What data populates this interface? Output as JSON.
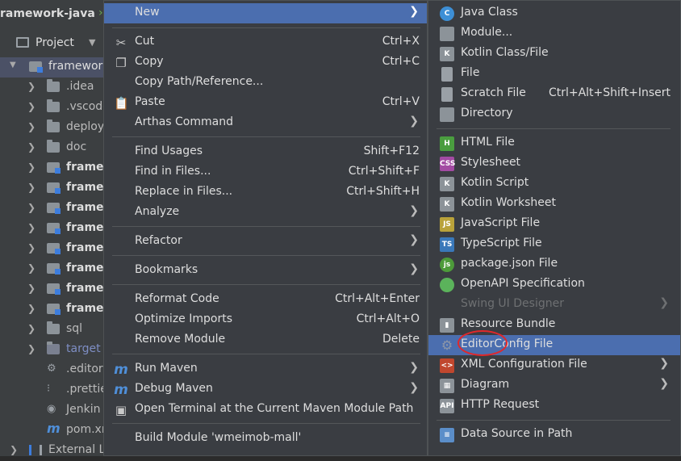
{
  "window": {
    "breadcrumb": "ramework-java"
  },
  "project_panel": {
    "header": "Project",
    "tree": [
      {
        "label": "framework",
        "type": "module",
        "expanded": true,
        "selected": true
      },
      {
        "label": ".idea",
        "type": "folder"
      },
      {
        "label": ".vscode",
        "type": "folder"
      },
      {
        "label": "deploy",
        "type": "folder"
      },
      {
        "label": "doc",
        "type": "folder"
      },
      {
        "label": "framew",
        "type": "module",
        "bold": true
      },
      {
        "label": "framew",
        "type": "module",
        "bold": true
      },
      {
        "label": "framew",
        "type": "module",
        "bold": true
      },
      {
        "label": "framew",
        "type": "module",
        "bold": true
      },
      {
        "label": "framew",
        "type": "module",
        "bold": true
      },
      {
        "label": "framew",
        "type": "module",
        "bold": true
      },
      {
        "label": "framew",
        "type": "module",
        "bold": true
      },
      {
        "label": "framew",
        "type": "module",
        "bold": true
      },
      {
        "label": "sql",
        "type": "folder"
      },
      {
        "label": "target",
        "type": "folder",
        "excluded": true
      },
      {
        "label": ".editor",
        "type": "file"
      },
      {
        "label": ".prettie",
        "type": "file"
      },
      {
        "label": "Jenkin",
        "type": "file"
      },
      {
        "label": "pom.xr",
        "type": "file"
      },
      {
        "label": "External Li",
        "type": "lib"
      }
    ]
  },
  "context_menu": {
    "items": [
      {
        "label": "New",
        "submenu": true,
        "highlighted": true
      },
      {
        "sep": true
      },
      {
        "label": "Cut",
        "shortcut": "Ctrl+X",
        "icon": "scissors-icon"
      },
      {
        "label": "Copy",
        "shortcut": "Ctrl+C",
        "icon": "copy-icon"
      },
      {
        "label": "Copy Path/Reference..."
      },
      {
        "label": "Paste",
        "shortcut": "Ctrl+V",
        "icon": "paste-icon"
      },
      {
        "label": "Arthas Command",
        "submenu": true
      },
      {
        "sep": true
      },
      {
        "label": "Find Usages",
        "shortcut": "Shift+F12"
      },
      {
        "label": "Find in Files...",
        "shortcut": "Ctrl+Shift+F"
      },
      {
        "label": "Replace in Files...",
        "shortcut": "Ctrl+Shift+H"
      },
      {
        "label": "Analyze",
        "submenu": true
      },
      {
        "sep": true
      },
      {
        "label": "Refactor",
        "submenu": true
      },
      {
        "sep": true
      },
      {
        "label": "Bookmarks",
        "submenu": true
      },
      {
        "sep": true
      },
      {
        "label": "Reformat Code",
        "shortcut": "Ctrl+Alt+Enter"
      },
      {
        "label": "Optimize Imports",
        "shortcut": "Ctrl+Alt+O"
      },
      {
        "label": "Remove Module",
        "shortcut": "Delete"
      },
      {
        "sep": true
      },
      {
        "label": "Run Maven",
        "submenu": true,
        "icon": "maven-icon"
      },
      {
        "label": "Debug Maven",
        "submenu": true,
        "icon": "maven-debug-icon"
      },
      {
        "label": "Open Terminal at the Current Maven Module Path",
        "icon": "terminal-icon"
      },
      {
        "sep": true
      },
      {
        "label": "Build Module 'wmeimob-mall'"
      }
    ]
  },
  "new_submenu": {
    "items": [
      {
        "label": "Java Class",
        "icon": "java-class-icon",
        "badge": "C",
        "color": "#3d8fd6",
        "round": true
      },
      {
        "label": "Module...",
        "icon": "module-icon",
        "color": "#8c9399"
      },
      {
        "label": "Kotlin Class/File",
        "icon": "kotlin-icon",
        "badge": "K",
        "color": "#8c9399"
      },
      {
        "label": "File",
        "icon": "file-icon",
        "color": "#9aa0a6"
      },
      {
        "label": "Scratch File",
        "shortcut": "Ctrl+Alt+Shift+Insert",
        "icon": "scratch-file-icon",
        "color": "#9aa0a6"
      },
      {
        "label": "Directory",
        "icon": "directory-icon",
        "color": "#8c9399"
      },
      {
        "sep": true
      },
      {
        "label": "HTML File",
        "icon": "html-icon",
        "badge": "H",
        "color": "#4a9d3f"
      },
      {
        "label": "Stylesheet",
        "icon": "css-icon",
        "badge": "CSS",
        "color": "#a34ba3"
      },
      {
        "label": "Kotlin Script",
        "icon": "kotlin-script-icon",
        "badge": "K",
        "color": "#8c9399"
      },
      {
        "label": "Kotlin Worksheet",
        "icon": "kotlin-worksheet-icon",
        "badge": "K",
        "color": "#8c9399"
      },
      {
        "label": "JavaScript File",
        "icon": "javascript-icon",
        "badge": "JS",
        "color": "#b9a23a"
      },
      {
        "label": "TypeScript File",
        "icon": "typescript-icon",
        "badge": "TS",
        "color": "#3a78b9"
      },
      {
        "label": "package.json File",
        "icon": "nodejs-icon",
        "badge": "js",
        "color": "#4d9b3a",
        "round": true
      },
      {
        "label": "OpenAPI Specification",
        "icon": "openapi-icon",
        "badge": "",
        "color": "#5bb35b",
        "round": true
      },
      {
        "label": "Swing UI Designer",
        "submenu": true,
        "disabled": true
      },
      {
        "label": "Resource Bundle",
        "icon": "resource-bundle-icon",
        "badge": "▮",
        "color": "#8c9399"
      },
      {
        "label": "EditorConfig File",
        "icon": "gear-icon",
        "badge": "⚙",
        "color": "#6b7a99",
        "highlighted": true
      },
      {
        "label": "XML Configuration File",
        "submenu": true,
        "icon": "xml-icon",
        "badge": "<>",
        "color": "#c0472e"
      },
      {
        "label": "Diagram",
        "submenu": true,
        "icon": "diagram-icon",
        "badge": "▦",
        "color": "#8c9399"
      },
      {
        "label": "HTTP Request",
        "icon": "api-icon",
        "badge": "API",
        "color": "#8c9399"
      },
      {
        "sep": true
      },
      {
        "label": "Data Source in Path",
        "icon": "database-icon",
        "badge": "≡",
        "color": "#5b8ec9"
      }
    ]
  }
}
